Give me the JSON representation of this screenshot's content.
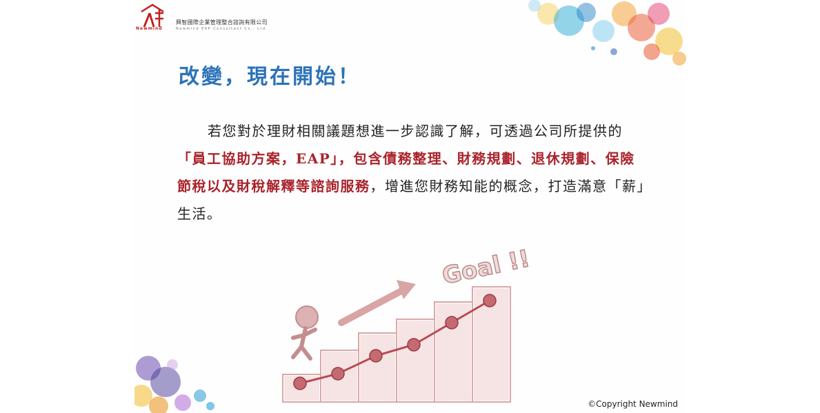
{
  "header": {
    "logo_text": "Newmind",
    "company_name_zh": "興智國際企業管理整合諮詢有限公司",
    "company_name_en": "Newmind EAP Consultant Co., Ltd."
  },
  "title": "改變，現在開始！",
  "body": {
    "part1": "若您對於理財相關議題想進一步認識了解，可透過公司所提供的",
    "highlight": "「員工協助方案，EAP」，包含債務整理、財務規劃、退休規劃、保險節稅以及財稅解釋等諮詢服務",
    "part2": "，增進您財務知能的概念，打造滿意「薪」生活。"
  },
  "illustration": {
    "goal_text": "Goal !!"
  },
  "footer": {
    "copyright": "©Copyright Newmind"
  },
  "colors": {
    "title": "#2b73b8",
    "highlight": "#a9232b",
    "logo": "#c0201e"
  }
}
